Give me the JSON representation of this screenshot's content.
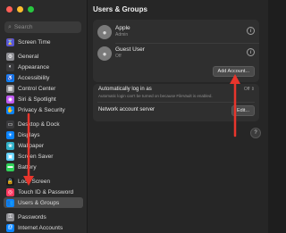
{
  "search": {
    "placeholder": "Search"
  },
  "sidebar": {
    "items": [
      {
        "label": "Screen Time",
        "icon": "hourglass-icon",
        "color": "#5856d6",
        "glyph": "⌛"
      },
      {
        "label": "General",
        "icon": "gear-icon",
        "color": "#8e8e93",
        "glyph": "⚙"
      },
      {
        "label": "Appearance",
        "icon": "appearance-icon",
        "color": "#3a3a3c",
        "glyph": "◐"
      },
      {
        "label": "Accessibility",
        "icon": "accessibility-icon",
        "color": "#0a84ff",
        "glyph": "♿"
      },
      {
        "label": "Control Center",
        "icon": "control-center-icon",
        "color": "#8e8e93",
        "glyph": "▦"
      },
      {
        "label": "Siri & Spotlight",
        "icon": "siri-icon",
        "color": "#bf5af2",
        "glyph": "◉"
      },
      {
        "label": "Privacy & Security",
        "icon": "hand-icon",
        "color": "#0a84ff",
        "glyph": "✋"
      },
      {
        "label": "Desktop & Dock",
        "icon": "dock-icon",
        "color": "#3a3a3c",
        "glyph": "▭"
      },
      {
        "label": "Displays",
        "icon": "display-icon",
        "color": "#0a84ff",
        "glyph": "☀"
      },
      {
        "label": "Wallpaper",
        "icon": "wallpaper-icon",
        "color": "#30b0c7",
        "glyph": "❀"
      },
      {
        "label": "Screen Saver",
        "icon": "screen-saver-icon",
        "color": "#64d2ff",
        "glyph": "▣"
      },
      {
        "label": "Battery",
        "icon": "battery-icon",
        "color": "#30d158",
        "glyph": "▬"
      },
      {
        "label": "Lock Screen",
        "icon": "lock-icon",
        "color": "#1c1c1e",
        "glyph": "🔒"
      },
      {
        "label": "Touch ID & Password",
        "icon": "fingerprint-icon",
        "color": "#ff375f",
        "glyph": "◎"
      },
      {
        "label": "Users & Groups",
        "icon": "users-icon",
        "color": "#0a84ff",
        "glyph": "👥"
      },
      {
        "label": "Passwords",
        "icon": "key-icon",
        "color": "#8e8e93",
        "glyph": "⚿"
      },
      {
        "label": "Internet Accounts",
        "icon": "at-icon",
        "color": "#0a84ff",
        "glyph": "@"
      }
    ]
  },
  "main": {
    "title": "Users & Groups",
    "users": [
      {
        "name": "Apple",
        "role": "Admin"
      },
      {
        "name": "Guest User",
        "role": "Off"
      }
    ],
    "add_account_label": "Add Account...",
    "auto_login_label": "Automatically log in as",
    "auto_login_value": "Off",
    "auto_login_note": "Automatic login can't be turned on because FileVault is enabled.",
    "network_server_label": "Network account server",
    "edit_label": "Edit...",
    "help_label": "?"
  },
  "colors": {
    "arrow": "#e8352c"
  }
}
